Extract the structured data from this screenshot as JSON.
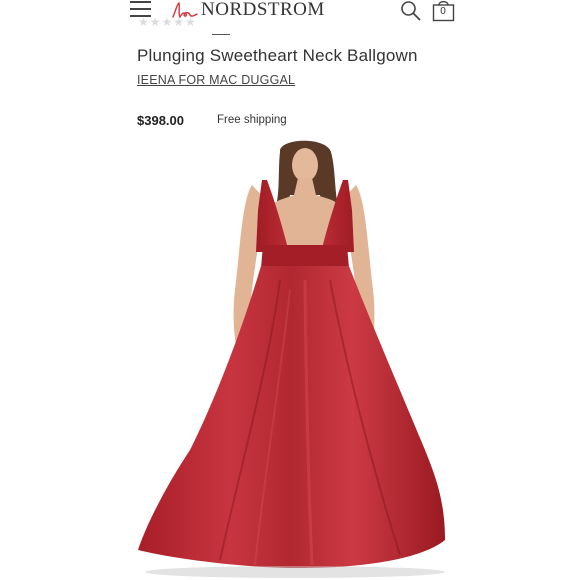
{
  "header": {
    "logo_text": "NORDSTROM",
    "logo_script": "la",
    "bag_count": "0",
    "rating_stars": "★★★★★",
    "icons": [
      "menu-icon",
      "search-icon",
      "shopping-bag-icon"
    ]
  },
  "product": {
    "title": "Plunging Sweetheart Neck Ballgown",
    "brand": "IEENA FOR MAC DUGGAL",
    "price": "$398.00",
    "shipping": "Free shipping",
    "image_color": "#b5262e"
  }
}
